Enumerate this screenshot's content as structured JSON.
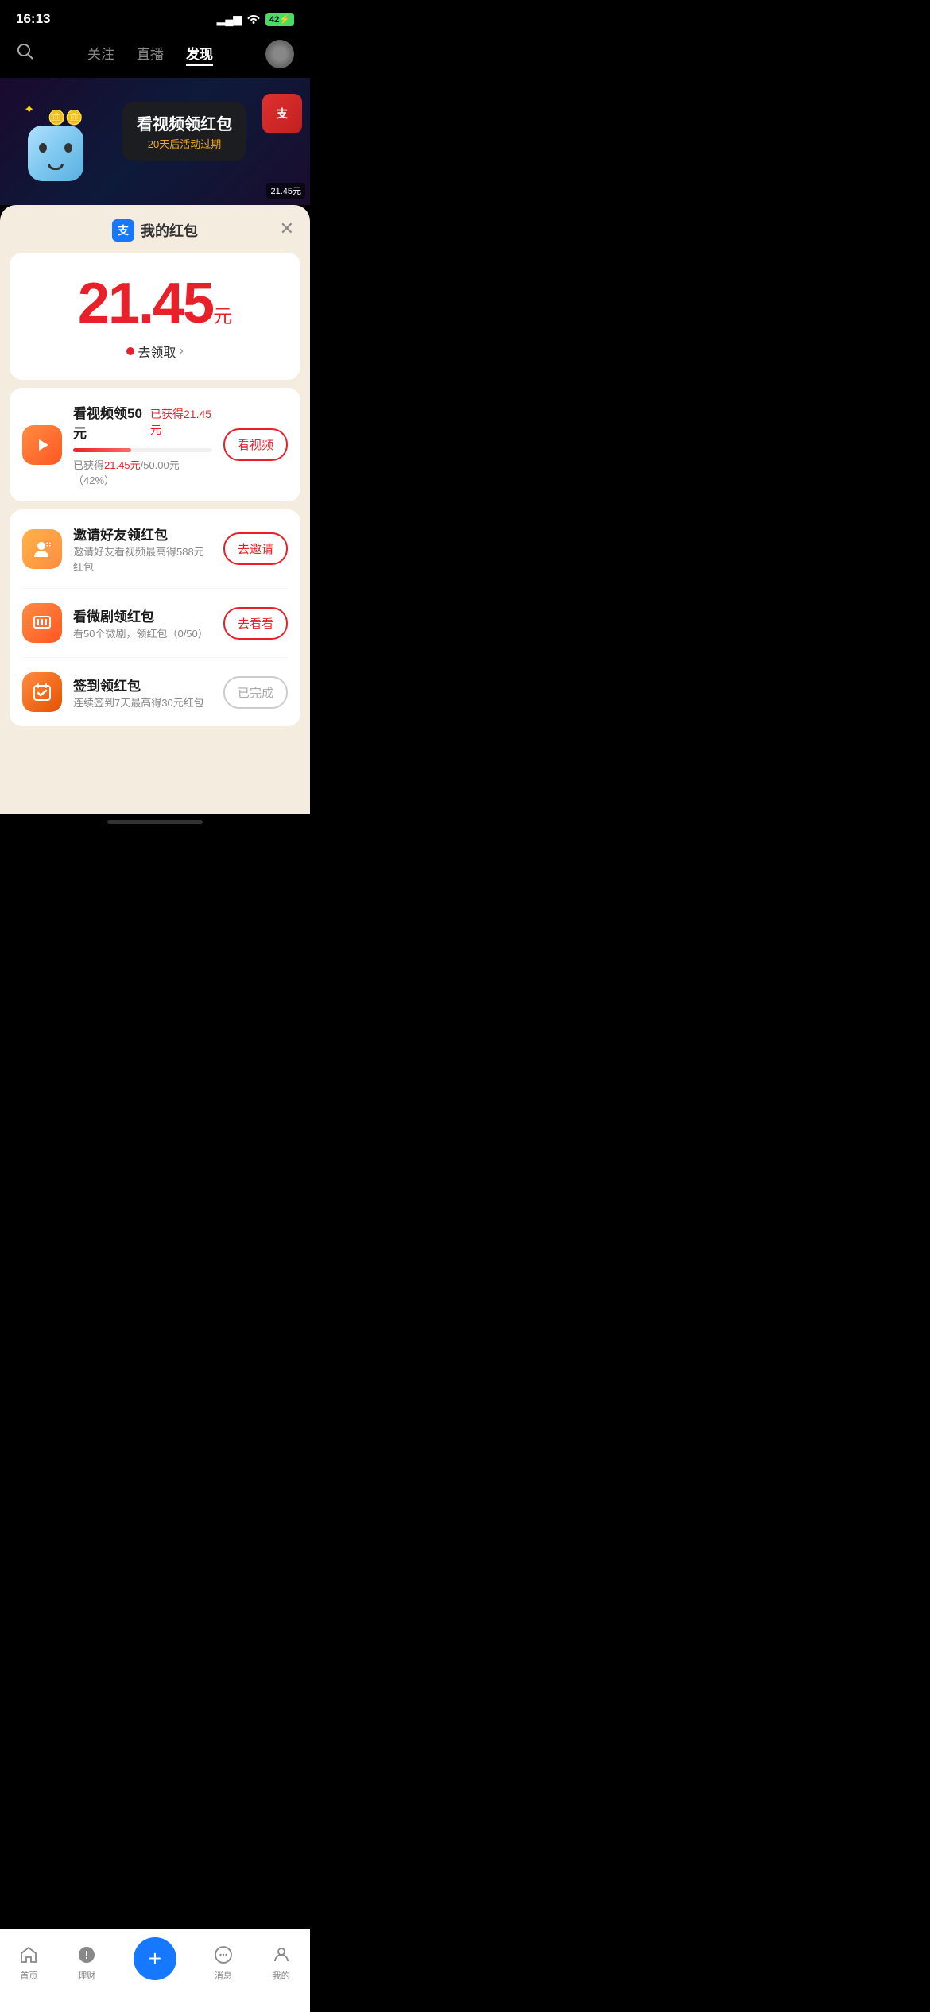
{
  "statusBar": {
    "time": "16:13",
    "battery": "42",
    "batteryIcon": "⚡"
  },
  "topNav": {
    "tabs": [
      {
        "label": "关注",
        "active": false
      },
      {
        "label": "直播",
        "active": false
      },
      {
        "label": "发现",
        "active": true
      }
    ]
  },
  "heroBanner": {
    "bubbleTitle": "看视频领红包",
    "bubbleSub": "20天后活动过期",
    "cornerAmount": "21.45元"
  },
  "sheet": {
    "title": "我的红包",
    "logoText": "支"
  },
  "mainCard": {
    "amount": "21.45",
    "unit": "元",
    "collectText": "去领取"
  },
  "tasks": {
    "watchVideo": {
      "title": "看视频领50元",
      "earned": "已获得21.45元",
      "progressPercent": 42,
      "progressText": "已获得21.45元/50.00元（42%）",
      "earnedAmt": "21.45元",
      "totalAmt": "50.00元",
      "percent": "42%",
      "btnLabel": "看视频"
    },
    "invite": {
      "title": "邀请好友领红包",
      "sub": "邀请好友看视频最高得588元红包",
      "btnLabel": "去邀请"
    },
    "drama": {
      "title": "看微剧领红包",
      "sub": "看50个微剧，领红包（0/50）",
      "btnLabel": "去看看"
    },
    "checkin": {
      "title": "签到领红包",
      "sub": "连续签到7天最高得30元红包",
      "btnLabel": "已完成"
    }
  },
  "bottomNav": {
    "items": [
      {
        "label": "首页",
        "active": false
      },
      {
        "label": "理财",
        "active": false
      },
      {
        "label": "+",
        "isAdd": true
      },
      {
        "label": "消息",
        "active": false
      },
      {
        "label": "我的",
        "active": false
      }
    ]
  }
}
